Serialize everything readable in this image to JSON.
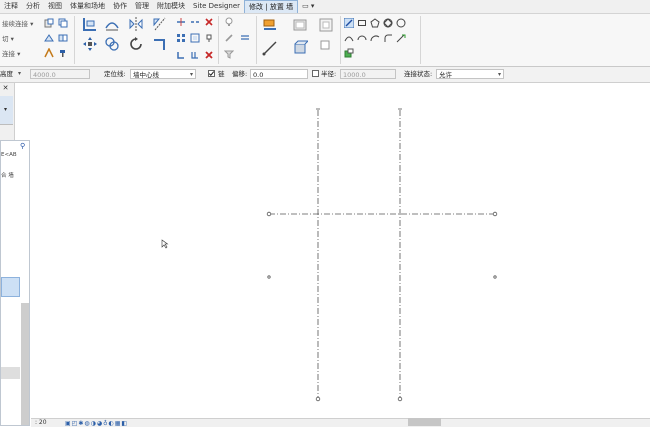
{
  "menu": [
    {
      "label": "注释",
      "active": false
    },
    {
      "label": "分析",
      "active": false
    },
    {
      "label": "视图",
      "active": false
    },
    {
      "label": "体量和场地",
      "active": false
    },
    {
      "label": "协作",
      "active": false
    },
    {
      "label": "管理",
      "active": false
    },
    {
      "label": "附加模块",
      "active": false
    },
    {
      "label": "Site Designer",
      "active": false
    },
    {
      "label": "修改 | 放置 墙",
      "active": true
    },
    {
      "label": "▭ ▾",
      "active": false
    }
  ],
  "ribbon": {
    "left_labels": [
      "接续连接 ▾",
      "切 ▾",
      "连接 ▾"
    ]
  },
  "options_bar": {
    "height_label": "高度",
    "height_value": "4000.0",
    "location_line_label": "定位线:",
    "location_line_value": "墙中心线",
    "chain_label": "链",
    "chain_checked": true,
    "offset_label": "偏移:",
    "offset_value": "0.0",
    "radius_label": "半径:",
    "radius_checked": false,
    "radius_value": "1000.0",
    "join_status_label": "连接状态:",
    "join_status_value": "允许"
  },
  "properties_panel": {
    "close_icon": "✕"
  },
  "project_browser": {
    "row1": "E<AB",
    "row2": "合 墙"
  },
  "status_bar": {
    "scale": ": 20"
  },
  "colors": {
    "accent": "#2c5fa8",
    "active_tab": "#dce8f5",
    "canvas": "#ffffff"
  }
}
